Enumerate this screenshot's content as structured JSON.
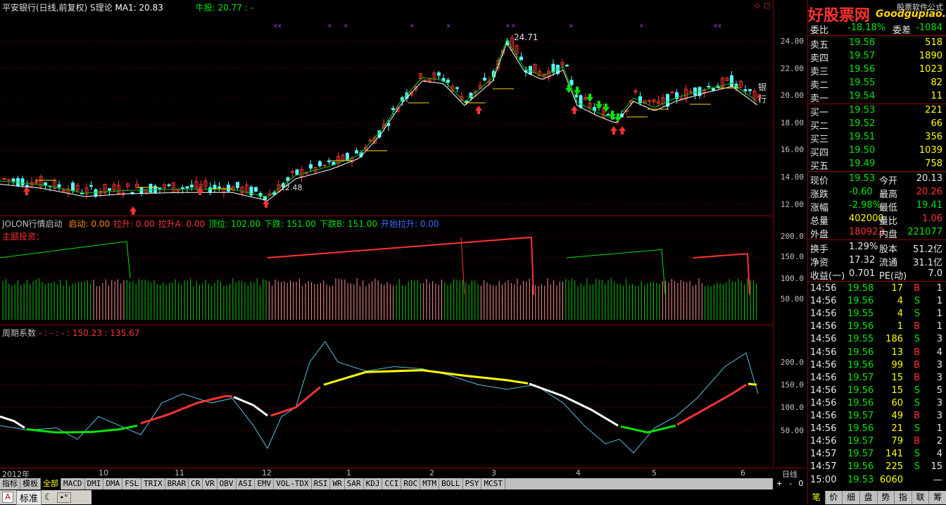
{
  "top_title": {
    "stock": "平安银行(日线,前复权)",
    "theory": "S理论",
    "ma_label": "MA1: 20.83",
    "bull_label": "牛股: 20.77 : -"
  },
  "pane1": {
    "yticks": [
      "24.00",
      "22.00",
      "20.00",
      "18.00",
      "16.00",
      "14.00",
      "12.00"
    ],
    "peak_label": "24.71",
    "low_label": "12.48",
    "bank_label": "银行",
    "dollar": "$"
  },
  "pane2": {
    "title": "JOLON行情启动",
    "items": [
      {
        "label": "启动: 0.00",
        "color": "#ff8c00"
      },
      {
        "label": "拉升: 0.00",
        "color": "#ff3232"
      },
      {
        "label": "拉升A: 0.00",
        "color": "#ff3232"
      },
      {
        "label": "顶位: 102.00",
        "color": "#00e600"
      },
      {
        "label": "下跌: 151.00",
        "color": "#00e600"
      },
      {
        "label": "下跌B: 151.00",
        "color": "#00e600"
      },
      {
        "label": "开始拉升: 0.00",
        "color": "#3c6cff"
      }
    ],
    "sub_label": "主题投资：",
    "yticks": [
      "200.0",
      "150.0",
      "100.0",
      "50.00"
    ]
  },
  "pane3": {
    "title": "周期系数",
    "values": "- : - : - : 150.23 : 135.67",
    "yticks": [
      "200.0",
      "150.0",
      "100.0",
      "50.00"
    ]
  },
  "xaxis": {
    "labels": [
      "2012年",
      "10",
      "11",
      "12",
      "1",
      "2",
      "3",
      "4",
      "5",
      "6"
    ],
    "period": "日线"
  },
  "tabs": [
    "指标",
    "模板",
    "全部",
    "MACD",
    "DMI",
    "DMA",
    "FSL",
    "TRIX",
    "BRAR",
    "CR",
    "VR",
    "OBV",
    "ASI",
    "EMV",
    "VOL-TDX",
    "RSI",
    "WR",
    "SAR",
    "KDJ",
    "CCI",
    "ROC",
    "MTM",
    "BOLL",
    "PSY",
    "MCST"
  ],
  "active_tab": "全部",
  "bottom_left": {
    "std_label": "标准"
  },
  "zoom": {
    "plus": "+",
    "minus": "-",
    "zero": "0"
  },
  "quote": {
    "watermark": "好股票网",
    "watermark_url": "Goodgupiao.com",
    "watermark_sub": "股票软件公式",
    "weibi": {
      "label": "委比",
      "value": "-18.18%",
      "label2": "委差",
      "value2": "-1084"
    },
    "sells": [
      {
        "label": "卖五",
        "price": "19.58",
        "vol": "518"
      },
      {
        "label": "卖四",
        "price": "19.57",
        "vol": "1890"
      },
      {
        "label": "卖三",
        "price": "19.56",
        "vol": "1023"
      },
      {
        "label": "卖二",
        "price": "19.55",
        "vol": "82"
      },
      {
        "label": "卖一",
        "price": "19.54",
        "vol": "11"
      }
    ],
    "buys": [
      {
        "label": "买一",
        "price": "19.53",
        "vol": "221"
      },
      {
        "label": "买二",
        "price": "19.52",
        "vol": "66"
      },
      {
        "label": "买三",
        "price": "19.51",
        "vol": "356"
      },
      {
        "label": "买四",
        "price": "19.50",
        "vol": "1039"
      },
      {
        "label": "买五",
        "price": "19.49",
        "vol": "758"
      }
    ],
    "stats": [
      {
        "l1": "现价",
        "v1": "19.53",
        "c1": "green",
        "l2": "今开",
        "v2": "20.13",
        "c2": "white"
      },
      {
        "l1": "涨跌",
        "v1": "-0.60",
        "c1": "green",
        "l2": "最高",
        "v2": "20.26",
        "c2": "red"
      },
      {
        "l1": "涨幅",
        "v1": "-2.98%",
        "c1": "green",
        "l2": "最低",
        "v2": "19.41",
        "c2": "green"
      },
      {
        "l1": "总量",
        "v1": "402000",
        "c1": "yellow",
        "l2": "量比",
        "v2": "1.06",
        "c2": "red"
      },
      {
        "l1": "外盘",
        "v1": "180923",
        "c1": "red",
        "l2": "内盘",
        "v2": "221077",
        "c2": "green"
      }
    ],
    "stats2": [
      {
        "l1": "换手",
        "v1": "1.29%",
        "l2": "股本",
        "v2": "51.2亿"
      },
      {
        "l1": "净资",
        "v1": "17.32",
        "l2": "流通",
        "v2": "31.1亿"
      },
      {
        "l1": "收益(一)",
        "v1": "0.701",
        "l2": "PE(动)",
        "v2": "7.0"
      }
    ],
    "ticks": [
      {
        "t": "14:56",
        "p": "19.58",
        "pc": "green",
        "v": "17",
        "bs": "B",
        "n": "1"
      },
      {
        "t": "14:56",
        "p": "19.56",
        "pc": "green",
        "v": "4",
        "bs": "S",
        "n": "1"
      },
      {
        "t": "14:56",
        "p": "19.55",
        "pc": "green",
        "v": "4",
        "bs": "S",
        "n": "1"
      },
      {
        "t": "14:56",
        "p": "19.56",
        "pc": "green",
        "v": "1",
        "bs": "B",
        "n": "1"
      },
      {
        "t": "14:56",
        "p": "19.55",
        "pc": "green",
        "v": "186",
        "bs": "S",
        "n": "3"
      },
      {
        "t": "14:56",
        "p": "19.56",
        "pc": "green",
        "v": "13",
        "bs": "B",
        "n": "4"
      },
      {
        "t": "14:56",
        "p": "19.56",
        "pc": "green",
        "v": "99",
        "bs": "B",
        "n": "3"
      },
      {
        "t": "14:56",
        "p": "19.57",
        "pc": "green",
        "v": "15",
        "bs": "B",
        "n": "3"
      },
      {
        "t": "14:56",
        "p": "19.56",
        "pc": "green",
        "v": "15",
        "bs": "S",
        "n": "5"
      },
      {
        "t": "14:56",
        "p": "19.56",
        "pc": "green",
        "v": "60",
        "bs": "S",
        "n": "3"
      },
      {
        "t": "14:56",
        "p": "19.57",
        "pc": "green",
        "v": "49",
        "bs": "B",
        "n": "3"
      },
      {
        "t": "14:56",
        "p": "19.56",
        "pc": "green",
        "v": "21",
        "bs": "S",
        "n": "1"
      },
      {
        "t": "14:56",
        "p": "19.57",
        "pc": "green",
        "v": "79",
        "bs": "B",
        "n": "2"
      },
      {
        "t": "14:57",
        "p": "19.57",
        "pc": "green",
        "v": "141",
        "bs": "S",
        "n": "4"
      },
      {
        "t": "14:57",
        "p": "19.56",
        "pc": "green",
        "v": "225",
        "bs": "S",
        "n": "15"
      },
      {
        "t": "15:00",
        "p": "19.53",
        "pc": "green",
        "v": "6060",
        "bs": "",
        "n": "—"
      }
    ],
    "bottom_tabs": [
      "笔",
      "价",
      "细",
      "盘",
      "势",
      "指",
      "联",
      "筹"
    ],
    "active_bottom": "笔"
  },
  "colors": {
    "up": "#ff3232",
    "down": "#54fcfc",
    "ma_white": "#ffffff",
    "ma_green": "#00c800",
    "grid_red": "#800000",
    "buy_line": "#ffd700"
  }
}
